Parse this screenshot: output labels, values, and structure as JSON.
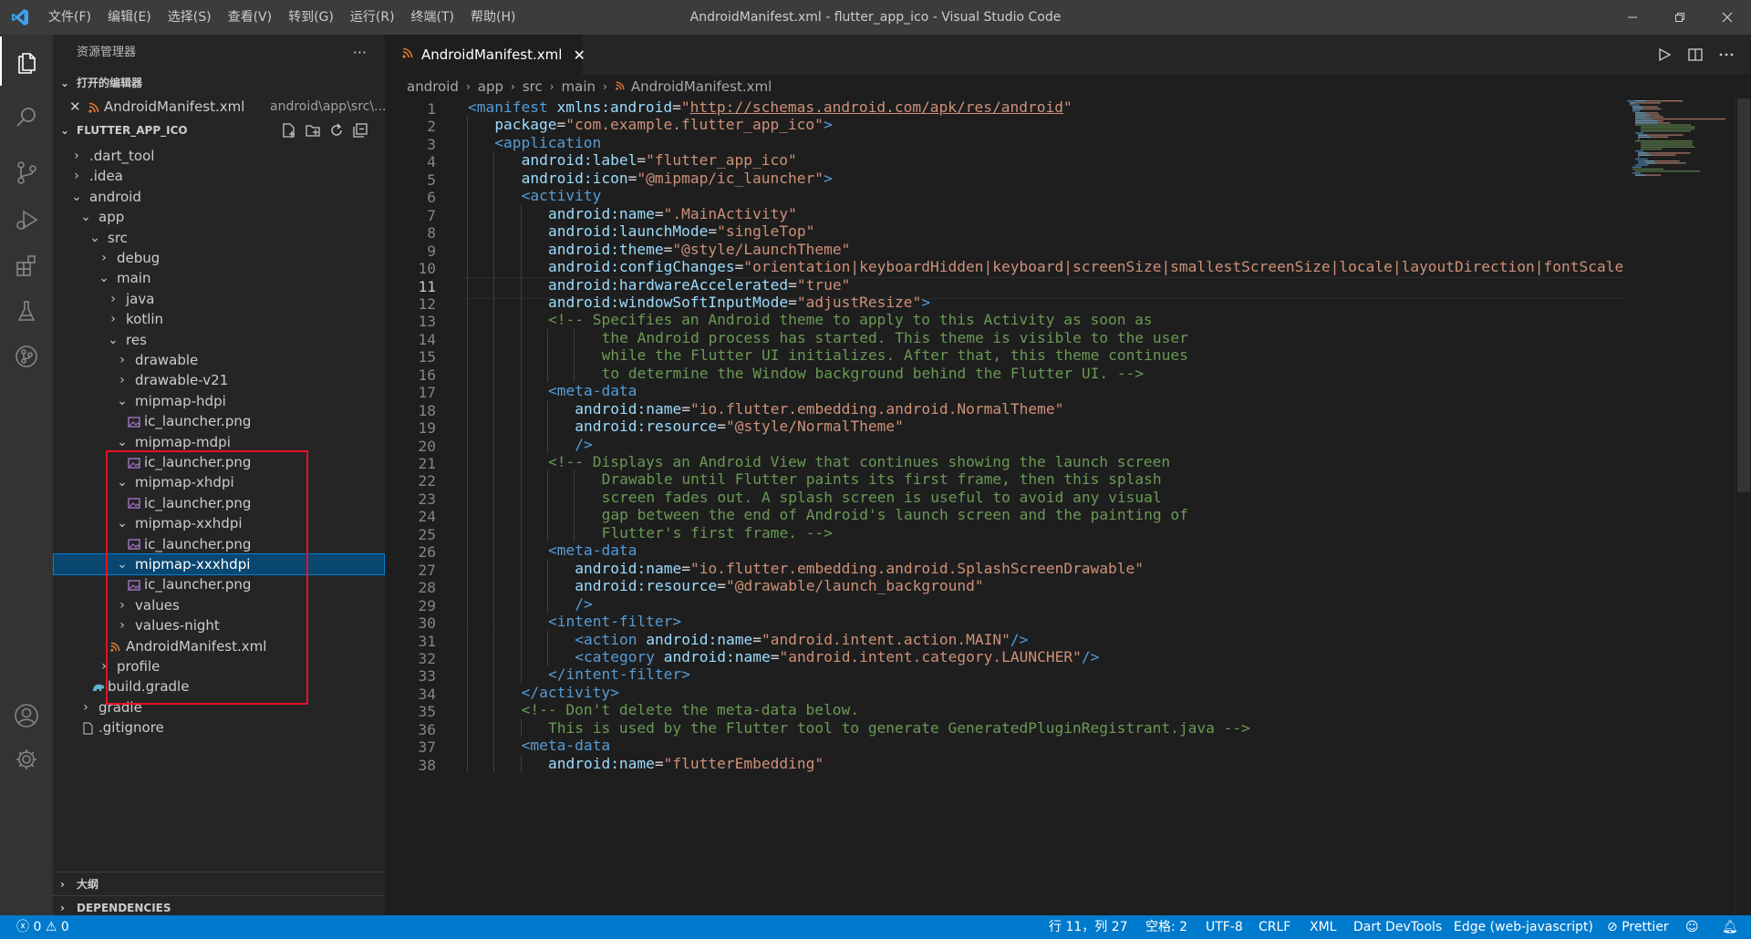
{
  "menubar": [
    "文件(F)",
    "编辑(E)",
    "选择(S)",
    "查看(V)",
    "转到(G)",
    "运行(R)",
    "终端(T)",
    "帮助(H)"
  ],
  "window_title": "AndroidManifest.xml - flutter_app_ico - Visual Studio Code",
  "activity_bar": [
    "explorer-icon",
    "search-icon",
    "source-control-icon",
    "run-debug-icon",
    "extensions-icon",
    "testing-icon",
    "git-graph-icon",
    "account-icon",
    "settings-icon"
  ],
  "sidebar": {
    "title": "资源管理器",
    "more": "···",
    "open_editors": {
      "label": "打开的编辑器",
      "file": "AndroidManifest.xml",
      "path": "android\\app\\src\\..."
    },
    "workspace": "FLUTTER_APP_ICO",
    "tree": [
      {
        "label": ".dart_tool",
        "type": "folder",
        "expanded": false
      },
      {
        "label": ".idea",
        "type": "folder",
        "expanded": false
      },
      {
        "label": "android",
        "type": "folder",
        "expanded": true
      },
      {
        "label": "app",
        "type": "folder",
        "expanded": true
      },
      {
        "label": "src",
        "type": "folder",
        "expanded": true
      },
      {
        "label": "debug",
        "type": "folder",
        "expanded": false
      },
      {
        "label": "main",
        "type": "folder",
        "expanded": true
      },
      {
        "label": "java",
        "type": "folder",
        "expanded": false
      },
      {
        "label": "kotlin",
        "type": "folder",
        "expanded": false
      },
      {
        "label": "res",
        "type": "folder",
        "expanded": true
      },
      {
        "label": "drawable",
        "type": "folder",
        "expanded": false
      },
      {
        "label": "drawable-v21",
        "type": "folder",
        "expanded": false
      },
      {
        "label": "mipmap-hdpi",
        "type": "folder",
        "expanded": true
      },
      {
        "label": "ic_launcher.png",
        "type": "image"
      },
      {
        "label": "mipmap-mdpi",
        "type": "folder",
        "expanded": true
      },
      {
        "label": "ic_launcher.png",
        "type": "image"
      },
      {
        "label": "mipmap-xhdpi",
        "type": "folder",
        "expanded": true
      },
      {
        "label": "ic_launcher.png",
        "type": "image"
      },
      {
        "label": "mipmap-xxhdpi",
        "type": "folder",
        "expanded": true
      },
      {
        "label": "ic_launcher.png",
        "type": "image"
      },
      {
        "label": "mipmap-xxxhdpi",
        "type": "folder",
        "expanded": true,
        "selected": true
      },
      {
        "label": "ic_launcher.png",
        "type": "image"
      },
      {
        "label": "values",
        "type": "folder",
        "expanded": false
      },
      {
        "label": "values-night",
        "type": "folder",
        "expanded": false
      },
      {
        "label": "AndroidManifest.xml",
        "type": "xml"
      },
      {
        "label": "profile",
        "type": "folder",
        "expanded": false
      },
      {
        "label": "build.gradle",
        "type": "gradle"
      },
      {
        "label": "gradle",
        "type": "folder",
        "expanded": false
      },
      {
        "label": ".gitignore",
        "type": "file"
      }
    ],
    "outline": "大纲",
    "dependencies": "DEPENDENCIES"
  },
  "tab": {
    "label": "AndroidManifest.xml",
    "close": "✕"
  },
  "breadcrumb": [
    "android",
    "app",
    "src",
    "main",
    "AndroidManifest.xml"
  ],
  "editor": {
    "current_line": 11,
    "lines": [
      {
        "indent": 0,
        "tokens": [
          [
            "t-tag",
            "<manifest "
          ],
          [
            "t-attr",
            "xmlns:android"
          ],
          [
            "",
            "="
          ],
          [
            "t-str",
            "\""
          ],
          [
            "t-link",
            "http://schemas.android.com/apk/res/android"
          ],
          [
            "t-str",
            "\""
          ]
        ]
      },
      {
        "indent": 1,
        "tokens": [
          [
            "t-attr",
            "package"
          ],
          [
            "",
            "="
          ],
          [
            "t-str",
            "\"com.example.flutter_app_ico\""
          ],
          [
            "t-tag",
            ">"
          ]
        ]
      },
      {
        "indent": 1,
        "tokens": [
          [
            "t-tag",
            "<application"
          ]
        ]
      },
      {
        "indent": 2,
        "tokens": [
          [
            "t-attr",
            "android:label"
          ],
          [
            "",
            "="
          ],
          [
            "t-str",
            "\"flutter_app_ico\""
          ]
        ]
      },
      {
        "indent": 2,
        "tokens": [
          [
            "t-attr",
            "android:icon"
          ],
          [
            "",
            "="
          ],
          [
            "t-str",
            "\"@mipmap/ic_launcher\""
          ],
          [
            "t-tag",
            ">"
          ]
        ]
      },
      {
        "indent": 2,
        "tokens": [
          [
            "t-tag",
            "<activity"
          ]
        ]
      },
      {
        "indent": 3,
        "tokens": [
          [
            "t-attr",
            "android:name"
          ],
          [
            "",
            "="
          ],
          [
            "t-str",
            "\".MainActivity\""
          ]
        ]
      },
      {
        "indent": 3,
        "tokens": [
          [
            "t-attr",
            "android:launchMode"
          ],
          [
            "",
            "="
          ],
          [
            "t-str",
            "\"singleTop\""
          ]
        ]
      },
      {
        "indent": 3,
        "tokens": [
          [
            "t-attr",
            "android:theme"
          ],
          [
            "",
            "="
          ],
          [
            "t-str",
            "\"@style/LaunchTheme\""
          ]
        ]
      },
      {
        "indent": 3,
        "tokens": [
          [
            "t-attr",
            "android:configChanges"
          ],
          [
            "",
            "="
          ],
          [
            "t-str",
            "\"orientation|keyboardHidden|keyboard|screenSize|smallestScreenSize|locale|layoutDirection|fontScale"
          ]
        ]
      },
      {
        "indent": 3,
        "tokens": [
          [
            "t-attr",
            "android:hardwareAccelerated"
          ],
          [
            "",
            "="
          ],
          [
            "t-str",
            "\"true\""
          ]
        ]
      },
      {
        "indent": 3,
        "tokens": [
          [
            "t-attr",
            "android:windowSoftInputMode"
          ],
          [
            "",
            "="
          ],
          [
            "t-str",
            "\"adjustResize\""
          ],
          [
            "t-tag",
            ">"
          ]
        ]
      },
      {
        "indent": 3,
        "tokens": [
          [
            "t-com",
            "<!-- Specifies an Android theme to apply to this Activity as soon as"
          ]
        ]
      },
      {
        "indent": 5,
        "tokens": [
          [
            "t-com",
            "the Android process has started. This theme is visible to the user"
          ]
        ]
      },
      {
        "indent": 5,
        "tokens": [
          [
            "t-com",
            "while the Flutter UI initializes. After that, this theme continues"
          ]
        ]
      },
      {
        "indent": 5,
        "tokens": [
          [
            "t-com",
            "to determine the Window background behind the Flutter UI. -->"
          ]
        ]
      },
      {
        "indent": 3,
        "tokens": [
          [
            "t-tag",
            "<meta-data"
          ]
        ]
      },
      {
        "indent": 4,
        "tokens": [
          [
            "t-attr",
            "android:name"
          ],
          [
            "",
            "="
          ],
          [
            "t-str",
            "\"io.flutter.embedding.android.NormalTheme\""
          ]
        ]
      },
      {
        "indent": 4,
        "tokens": [
          [
            "t-attr",
            "android:resource"
          ],
          [
            "",
            "="
          ],
          [
            "t-str",
            "\"@style/NormalTheme\""
          ]
        ]
      },
      {
        "indent": 4,
        "tokens": [
          [
            "t-tag",
            "/>"
          ]
        ]
      },
      {
        "indent": 3,
        "tokens": [
          [
            "t-com",
            "<!-- Displays an Android View that continues showing the launch screen"
          ]
        ]
      },
      {
        "indent": 5,
        "tokens": [
          [
            "t-com",
            "Drawable until Flutter paints its first frame, then this splash"
          ]
        ]
      },
      {
        "indent": 5,
        "tokens": [
          [
            "t-com",
            "screen fades out. A splash screen is useful to avoid any visual"
          ]
        ]
      },
      {
        "indent": 5,
        "tokens": [
          [
            "t-com",
            "gap between the end of Android's launch screen and the painting of"
          ]
        ]
      },
      {
        "indent": 5,
        "tokens": [
          [
            "t-com",
            "Flutter's first frame. -->"
          ]
        ]
      },
      {
        "indent": 3,
        "tokens": [
          [
            "t-tag",
            "<meta-data"
          ]
        ]
      },
      {
        "indent": 4,
        "tokens": [
          [
            "t-attr",
            "android:name"
          ],
          [
            "",
            "="
          ],
          [
            "t-str",
            "\"io.flutter.embedding.android.SplashScreenDrawable\""
          ]
        ]
      },
      {
        "indent": 4,
        "tokens": [
          [
            "t-attr",
            "android:resource"
          ],
          [
            "",
            "="
          ],
          [
            "t-str",
            "\"@drawable/launch_background\""
          ]
        ]
      },
      {
        "indent": 4,
        "tokens": [
          [
            "t-tag",
            "/>"
          ]
        ]
      },
      {
        "indent": 3,
        "tokens": [
          [
            "t-tag",
            "<intent-filter>"
          ]
        ]
      },
      {
        "indent": 4,
        "tokens": [
          [
            "t-tag",
            "<action "
          ],
          [
            "t-attr",
            "android:name"
          ],
          [
            "",
            "="
          ],
          [
            "t-str",
            "\"android.intent.action.MAIN\""
          ],
          [
            "t-tag",
            "/>"
          ]
        ]
      },
      {
        "indent": 4,
        "tokens": [
          [
            "t-tag",
            "<category "
          ],
          [
            "t-attr",
            "android:name"
          ],
          [
            "",
            "="
          ],
          [
            "t-str",
            "\"android.intent.category.LAUNCHER\""
          ],
          [
            "t-tag",
            "/>"
          ]
        ]
      },
      {
        "indent": 3,
        "tokens": [
          [
            "t-tag",
            "</intent-filter>"
          ]
        ]
      },
      {
        "indent": 2,
        "tokens": [
          [
            "t-tag",
            "</activity>"
          ]
        ]
      },
      {
        "indent": 2,
        "tokens": [
          [
            "t-com",
            "<!-- Don't delete the meta-data below."
          ]
        ]
      },
      {
        "indent": 3,
        "tokens": [
          [
            "t-com",
            "This is used by the Flutter tool to generate GeneratedPluginRegistrant.java -->"
          ]
        ]
      },
      {
        "indent": 2,
        "tokens": [
          [
            "t-tag",
            "<meta-data"
          ]
        ]
      },
      {
        "indent": 3,
        "tokens": [
          [
            "t-attr",
            "android:name"
          ],
          [
            "",
            "="
          ],
          [
            "t-str",
            "\"flutterEmbedding\""
          ]
        ]
      }
    ]
  },
  "statusbar": {
    "errors": "0",
    "warnings": "0",
    "position": "行 11，列 27",
    "spaces": "空格: 2",
    "encoding": "UTF-8",
    "eol": "CRLF",
    "language": "XML",
    "dart": "Dart DevTools",
    "edge": "Edge (web-javascript)",
    "prettier": "Prettier"
  },
  "colors": {
    "accent": "#007acc",
    "selection": "#094771",
    "highlight_box": "#e81123"
  }
}
